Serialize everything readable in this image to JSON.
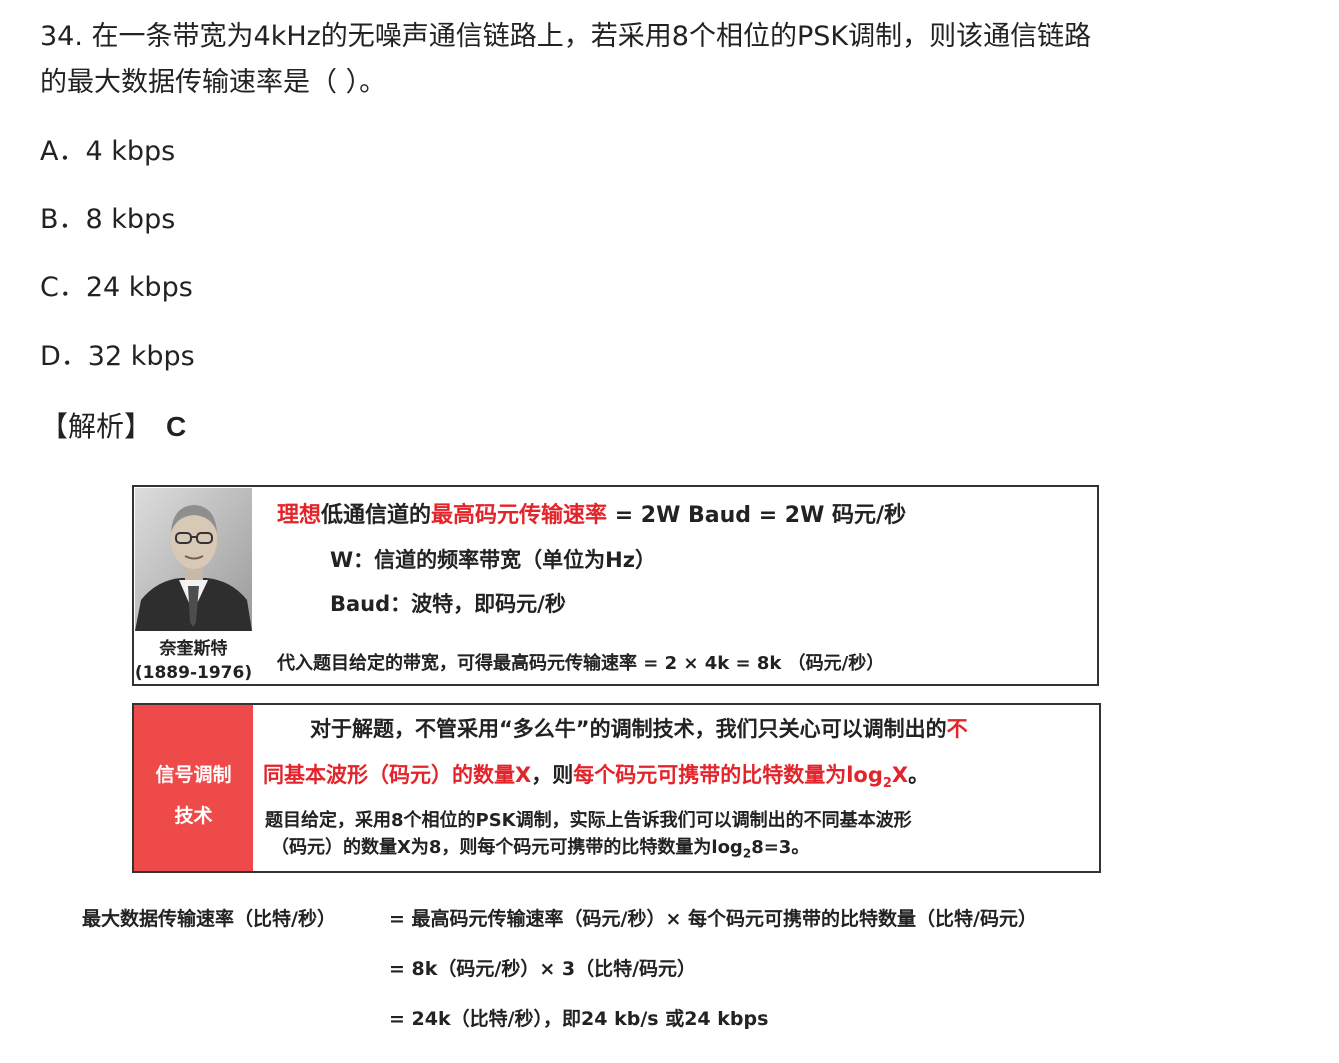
{
  "question": {
    "line1": "34. 在一条带宽为4kHz的无噪声通信链路上，若采用8个相位的PSK调制，则该通信链路",
    "line2": "的最大数据传输速率是（ ）。"
  },
  "options": [
    {
      "label": "A．",
      "text": "4 kbps"
    },
    {
      "label": "B．",
      "text": "8 kbps"
    },
    {
      "label": "C．",
      "text": "24 kbps"
    },
    {
      "label": "D．",
      "text": "32 kbps"
    }
  ],
  "answer": {
    "label": "【解析】",
    "value": "C"
  },
  "nyquist_box": {
    "person_name": "奈奎斯特",
    "person_years": "(1889-1976)",
    "formula_part1": "理想",
    "formula_part2": "低通信道的",
    "formula_part3": "最高码元传输速率",
    "formula_part4": " = 2W Baud = 2W 码元/秒",
    "w_def": "W：信道的频率带宽（单位为Hz）",
    "baud_def": "Baud：波特，即码元/秒",
    "substitute": "代入题目给定的带宽，可得最高码元传输速率 = 2 × 4k = 8k （码元/秒）"
  },
  "modulation_box": {
    "side_line1": "信号调制",
    "side_line2": "技术",
    "p1_black": "对于解题，不管采用“多么牛”的调制技术，我们只关心可以调制出的",
    "p1_red": "不",
    "p2_red1": "同基本波形（码元）的数量X",
    "p2_black": "，则",
    "p2_red2": "每个码元可携带的比特数量为log",
    "p2_sub": "2",
    "p2_red3": "X",
    "p2_end": "。",
    "p3": "题目给定，采用8个相位的PSK调制，实际上告诉我们可以调制出的不同基本波形",
    "p4_a": "（码元）的数量X为8，则每个码元可携带的比特数量为log",
    "p4_sub": "2",
    "p4_b": "8=3。"
  },
  "calculation": {
    "lhs": "最大数据传输速率（比特/秒）",
    "line1": "= 最高码元传输速率（码元/秒）× 每个码元可携带的比特数量（比特/码元）",
    "line2": "= 8k（码元/秒）× 3（比特/码元）",
    "line3": "= 24k（比特/秒），即24 kb/s 或24 kbps"
  }
}
